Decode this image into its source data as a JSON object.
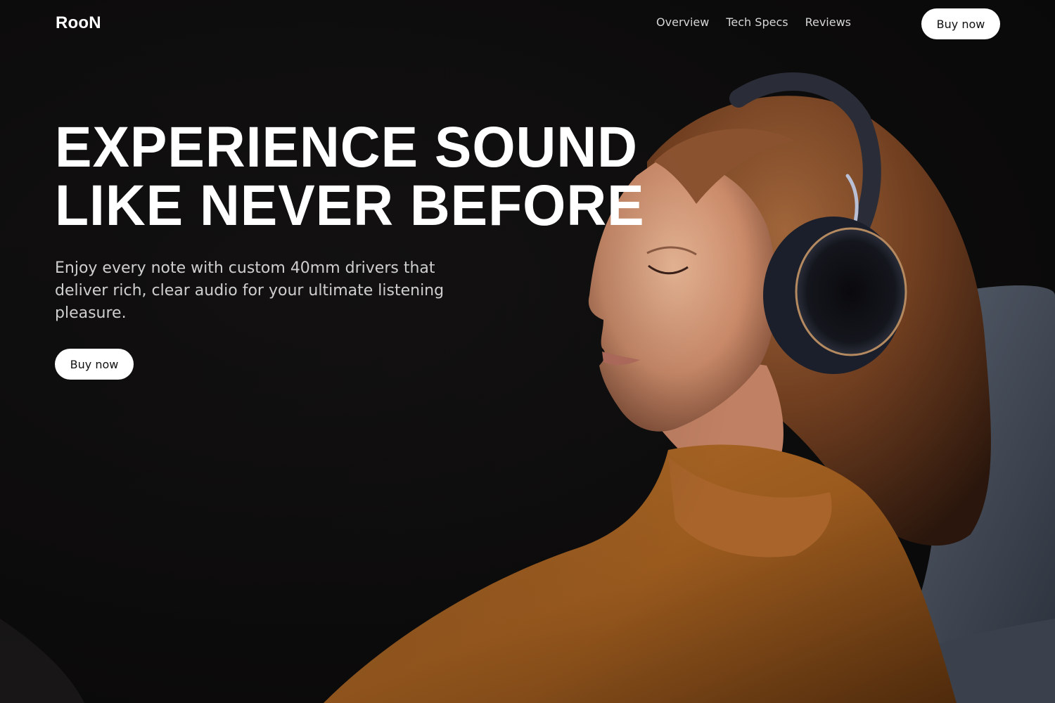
{
  "brand": {
    "logo": "RooN"
  },
  "nav": {
    "links": [
      "Overview",
      "Tech Specs",
      "Reviews"
    ],
    "buy_label": "Buy now"
  },
  "hero": {
    "headline_line1": "EXPERIENCE SOUND",
    "headline_line2": "LIKE NEVER BEFORE",
    "description": "Enjoy every note with custom 40mm drivers that deliver rich, clear audio for your ultimate listening pleasure.",
    "buy_label": "Buy now"
  },
  "colors": {
    "background": "#0d0c0c",
    "accent": "#ffffff",
    "sweater": "#9a5a1e",
    "hair": "#6e3d1f",
    "headphones": "#1b1f2b"
  },
  "image": {
    "subject": "woman with eyes closed wearing over-ear headphones, orange turtleneck sweater, reclining on grey chair"
  }
}
